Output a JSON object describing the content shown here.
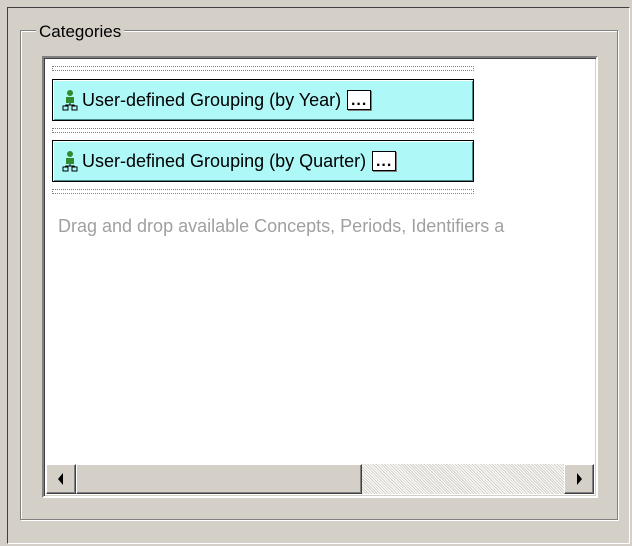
{
  "groupbox": {
    "title": "Categories"
  },
  "categories": [
    {
      "label": "User-defined Grouping (by Year)",
      "icon": "grouping-icon",
      "more_label": "..."
    },
    {
      "label": "User-defined Grouping (by Quarter)",
      "icon": "grouping-icon",
      "more_label": "..."
    }
  ],
  "hint": "Drag and drop available Concepts, Periods, Identifiers a",
  "scrollbar": {
    "left_icon": "arrow-left-icon",
    "right_icon": "arrow-right-icon"
  },
  "colors": {
    "chip_background": "#aff8f8",
    "grouping_icon": "#2e8b2e",
    "panel": "#d4d0c8"
  }
}
